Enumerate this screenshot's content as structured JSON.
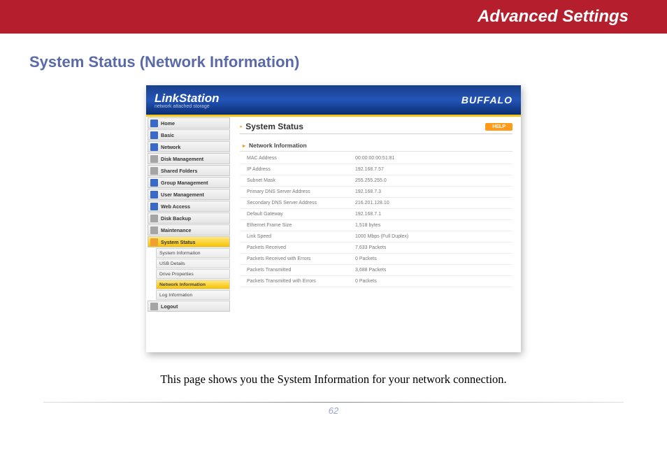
{
  "banner": {
    "title": "Advanced Settings"
  },
  "section": {
    "title": "System Status (Network Information)"
  },
  "app": {
    "logo_main": "LinkStation",
    "logo_sub": "network attached storage",
    "brand": "BUFFALO",
    "content_title": "System Status",
    "help": "HELP",
    "panel_title": "Network Information"
  },
  "nav": {
    "items": [
      {
        "label": "Home",
        "icon": "■",
        "cls": "ic-blue"
      },
      {
        "label": "Basic",
        "icon": "■",
        "cls": "ic-blue"
      },
      {
        "label": "Network",
        "icon": "■",
        "cls": "ic-blue"
      },
      {
        "label": "Disk Management",
        "icon": "■",
        "cls": "ic-gray"
      },
      {
        "label": "Shared Folders",
        "icon": "■",
        "cls": "ic-gray"
      },
      {
        "label": "Group Management",
        "icon": "■",
        "cls": "ic-blue"
      },
      {
        "label": "User Management",
        "icon": "■",
        "cls": "ic-blue"
      },
      {
        "label": "Web Access",
        "icon": "■",
        "cls": "ic-blue"
      },
      {
        "label": "Disk Backup",
        "icon": "■",
        "cls": "ic-gray"
      },
      {
        "label": "Maintenance",
        "icon": "■",
        "cls": "ic-gray"
      }
    ],
    "status_item": {
      "label": "System Status",
      "icon": "▮",
      "cls": "ic-orange"
    },
    "sub_items": [
      {
        "label": "System Information",
        "active": false
      },
      {
        "label": "USB Details",
        "active": false
      },
      {
        "label": "Drive Properties",
        "active": false
      },
      {
        "label": "Network Information",
        "active": true
      },
      {
        "label": "Log Information",
        "active": false
      }
    ],
    "logout": {
      "label": "Logout",
      "icon": "■",
      "cls": "ic-gray"
    }
  },
  "info": {
    "rows": [
      {
        "label": "MAC Address",
        "value": "00:00:00:00:51:81"
      },
      {
        "label": "IP Address",
        "value": "192.168.7.57"
      },
      {
        "label": "Subnet Mask",
        "value": "255.255.255.0"
      },
      {
        "label": "Primary DNS Server Address",
        "value": "192.168.7.3"
      },
      {
        "label": "Secondary DNS Server Address",
        "value": "216.201.128.10"
      },
      {
        "label": "Default Gateway",
        "value": "192.168.7.1"
      },
      {
        "label": "Ethernet Frame Size",
        "value": "1,518 bytes"
      },
      {
        "label": "Link Speed",
        "value": "1000 Mbps (Full Duplex)"
      },
      {
        "label": "Packets Received",
        "value": "7,633 Packets"
      },
      {
        "label": "Packets Received with Errors",
        "value": "0 Packets"
      },
      {
        "label": "Packets Transmitted",
        "value": "3,688 Packets"
      },
      {
        "label": "Packets Transmitted with Errors",
        "value": "0 Packets"
      }
    ]
  },
  "caption": "This page shows you the System Information for your network connection.",
  "page_number": "62"
}
